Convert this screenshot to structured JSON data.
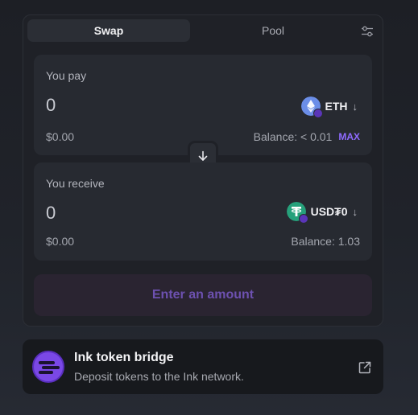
{
  "tabs": {
    "swap": "Swap",
    "pool": "Pool"
  },
  "pay": {
    "label": "You pay",
    "amount": "0",
    "usd": "$0.00",
    "token": "ETH",
    "token_icon": "ethereum-icon",
    "balance": "Balance: < 0.01",
    "max_label": "MAX"
  },
  "receive": {
    "label": "You receive",
    "amount": "0",
    "usd": "$0.00",
    "token": "USD₮0",
    "token_icon": "tether-icon",
    "balance": "Balance: 1.03"
  },
  "cta_label": "Enter an amount",
  "bridge": {
    "title": "Ink token bridge",
    "subtitle": "Deposit tokens to the Ink network."
  },
  "colors": {
    "accent": "#8f6bff",
    "ink_purple": "#6e3fe0",
    "eth_blue": "#6b8ee8",
    "tether_green": "#26a17b"
  }
}
